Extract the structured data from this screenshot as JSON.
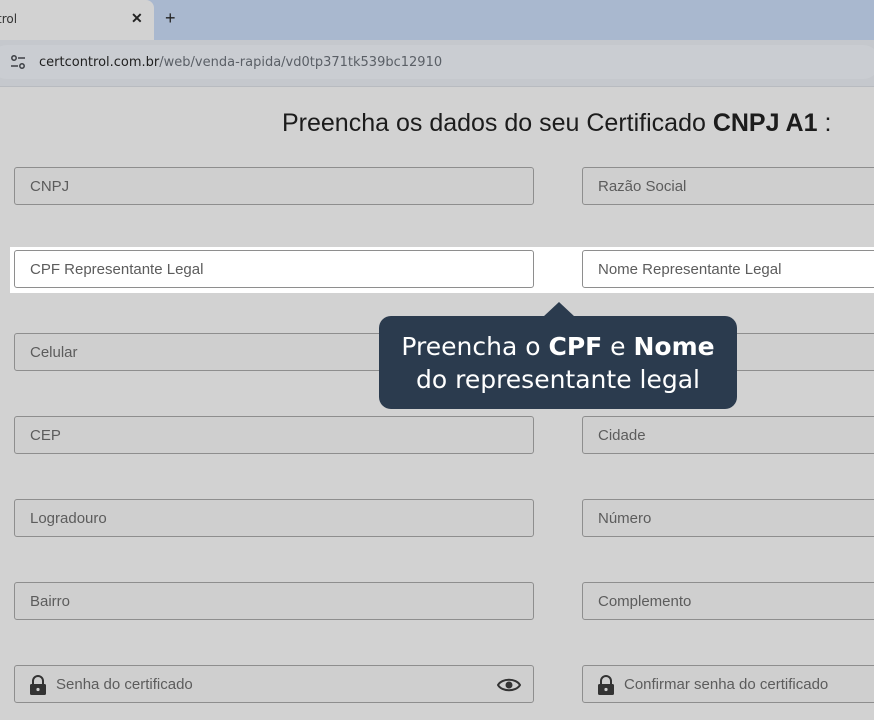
{
  "browser": {
    "tab_title": "trol",
    "tab_close": "✕",
    "new_tab": "+",
    "url_domain": "certcontrol.com.br",
    "url_path": "/web/venda-rapida/vd0tp371tk539bc12910"
  },
  "page": {
    "title_prefix": "Preencha os dados do seu Certificado ",
    "title_bold": "CNPJ A1",
    "title_suffix": " :"
  },
  "form": {
    "cnpj": "CNPJ",
    "razao_social": "Razão Social",
    "cpf_representante": "CPF Representante Legal",
    "nome_representante": "Nome Representante Legal",
    "celular": "Celular",
    "cep": "CEP",
    "cidade": "Cidade",
    "logradouro": "Logradouro",
    "numero": "Número",
    "bairro": "Bairro",
    "complemento": "Complemento",
    "senha": "Senha do certificado",
    "confirmar_senha": "Confirmar senha do certificado"
  },
  "tooltip": {
    "l1_a": "Preencha o ",
    "l1_b": "CPF",
    "l1_c": " e ",
    "l1_d": "Nome",
    "l2": "do representante legal"
  },
  "colors": {
    "tooltip_bg": "#2b3b4e",
    "tab_strip": "#a9b8cf"
  },
  "icons": [
    "site-settings-icon",
    "lock-icon",
    "eye-icon",
    "close-icon",
    "plus-icon"
  ]
}
